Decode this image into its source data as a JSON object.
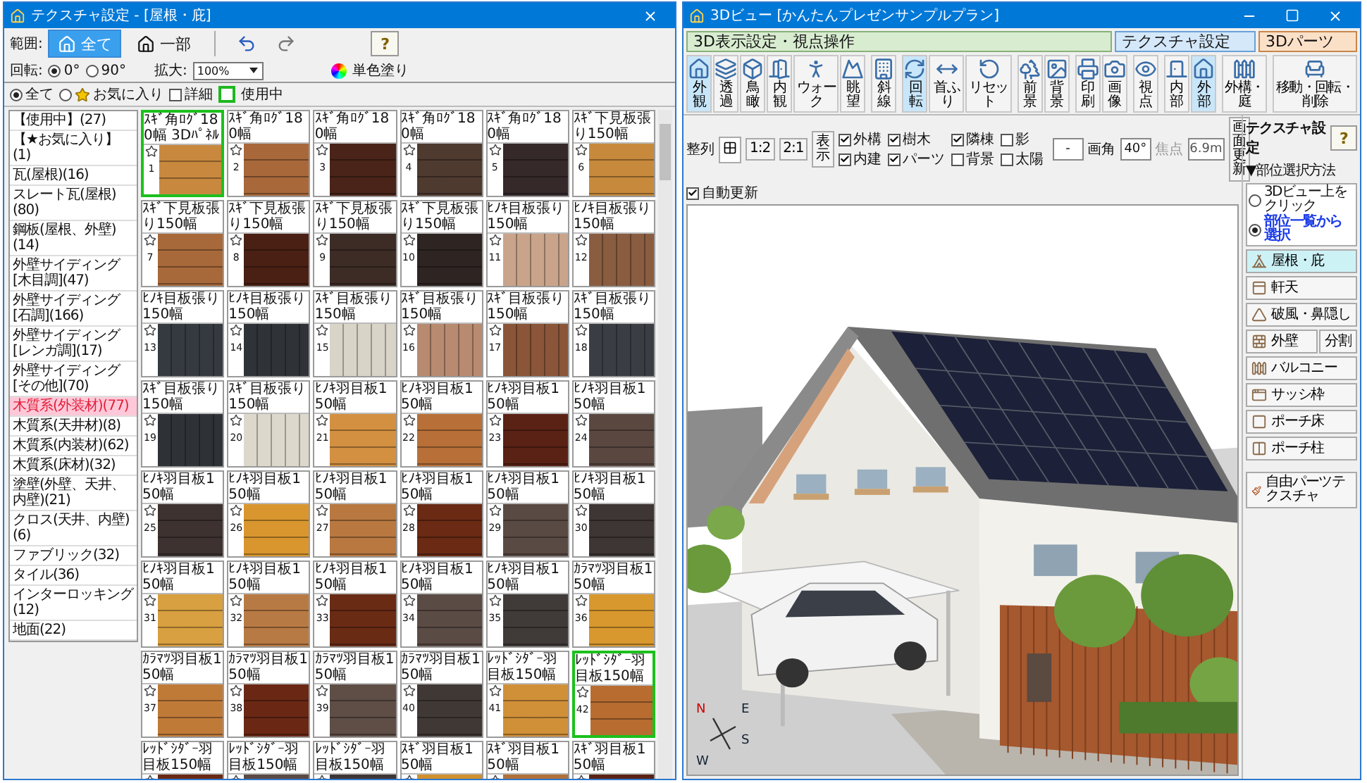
{
  "texture_window": {
    "title": "テクスチャ設定 - [屋根・庇]",
    "range_label": "範囲:",
    "range_options": [
      {
        "label": "全て",
        "selected": true
      },
      {
        "label": "一部",
        "selected": false
      }
    ],
    "help_button": "?",
    "rotation_label": "回転:",
    "rotation_options": [
      {
        "label": "0°",
        "selected": true
      },
      {
        "label": "90°",
        "selected": false
      }
    ],
    "zoom_label": "拡大:",
    "zoom_value": "100%",
    "solid_color_button": "単色塗り",
    "filter_options": [
      {
        "label": "全て",
        "selected": true,
        "kind": "plain"
      },
      {
        "label": "お気に入り",
        "selected": false,
        "kind": "favorite"
      }
    ],
    "detail_checkbox": {
      "label": "詳細",
      "checked": false
    },
    "in_use_legend": "使用中",
    "categories": [
      {
        "label": "【使用中】(27)",
        "selected": false
      },
      {
        "label": "【★お気に入り】(1)",
        "selected": false
      },
      {
        "label": "瓦(屋根)(16)",
        "selected": false
      },
      {
        "label": "スレート瓦(屋根)(80)",
        "selected": false
      },
      {
        "label": "鋼板(屋根、外壁)(14)",
        "selected": false
      },
      {
        "label": "外壁サイディング[木目調](47)",
        "selected": false
      },
      {
        "label": "外壁サイディング[石調](166)",
        "selected": false
      },
      {
        "label": "外壁サイディング[レンガ調](17)",
        "selected": false
      },
      {
        "label": "外壁サイディング[その他](70)",
        "selected": false
      },
      {
        "label": "木質系(外装材)(77)",
        "selected": true
      },
      {
        "label": "木質系(天井材)(8)",
        "selected": false
      },
      {
        "label": "木質系(内装材)(62)",
        "selected": false
      },
      {
        "label": "木質系(床材)(32)",
        "selected": false
      },
      {
        "label": "塗壁(外壁、天井、内壁)(21)",
        "selected": false
      },
      {
        "label": "クロス(天井、内壁)(6)",
        "selected": false
      },
      {
        "label": "ファブリック(32)",
        "selected": false
      },
      {
        "label": "タイル(36)",
        "selected": false
      },
      {
        "label": "インターロッキング(12)",
        "selected": false
      },
      {
        "label": "地面(22)",
        "selected": false
      }
    ],
    "textures": [
      {
        "name": "ｽｷﾞ角ﾛｸﾞ180幅 3Dﾊﾟﾈﾙ",
        "number": "1",
        "color": "#c8893e",
        "kind": "horizontal",
        "in_use": true
      },
      {
        "name": "ｽｷﾞ角ﾛｸﾞ180幅",
        "number": "2",
        "color": "#a8683a",
        "kind": "horizontal",
        "in_use": false
      },
      {
        "name": "ｽｷﾞ角ﾛｸﾞ180幅",
        "number": "3",
        "color": "#4a2418",
        "kind": "horizontal",
        "in_use": false
      },
      {
        "name": "ｽｷﾞ角ﾛｸﾞ180幅",
        "number": "4",
        "color": "#4f3a30",
        "kind": "horizontal",
        "in_use": false
      },
      {
        "name": "ｽｷﾞ角ﾛｸﾞ180幅",
        "number": "5",
        "color": "#35292a",
        "kind": "horizontal",
        "in_use": false
      },
      {
        "name": "ｽｷﾞ下見板張り150幅",
        "number": "6",
        "color": "#c78a3c",
        "kind": "horizontal",
        "in_use": false
      },
      {
        "name": "ｽｷﾞ下見板張り150幅",
        "number": "7",
        "color": "#a8693a",
        "kind": "horizontal",
        "in_use": false
      },
      {
        "name": "ｽｷﾞ下見板張り150幅",
        "number": "8",
        "color": "#4a2014",
        "kind": "horizontal",
        "in_use": false
      },
      {
        "name": "ｽｷﾞ下見板張り150幅",
        "number": "9",
        "color": "#3d2c26",
        "kind": "horizontal",
        "in_use": false
      },
      {
        "name": "ｽｷﾞ下見板張り150幅",
        "number": "10",
        "color": "#2e2522",
        "kind": "horizontal",
        "in_use": false
      },
      {
        "name": "ﾋﾉｷ目板張り150幅",
        "number": "11",
        "color": "#c9a48a",
        "kind": "vertical",
        "in_use": false
      },
      {
        "name": "ﾋﾉｷ目板張り150幅",
        "number": "12",
        "color": "#8a5c40",
        "kind": "vertical",
        "in_use": false
      },
      {
        "name": "ﾋﾉｷ目板張り150幅",
        "number": "13",
        "color": "#353a40",
        "kind": "vertical",
        "in_use": false
      },
      {
        "name": "ﾋﾉｷ目板張り150幅",
        "number": "14",
        "color": "#2f3338",
        "kind": "vertical",
        "in_use": false
      },
      {
        "name": "ｽｷﾞ目板張り150幅",
        "number": "15",
        "color": "#d8d4c8",
        "kind": "vertical",
        "in_use": false
      },
      {
        "name": "ｽｷﾞ目板張り150幅",
        "number": "16",
        "color": "#b88a70",
        "kind": "vertical",
        "in_use": false
      },
      {
        "name": "ｽｷﾞ目板張り150幅",
        "number": "17",
        "color": "#8a5538",
        "kind": "vertical",
        "in_use": false
      },
      {
        "name": "ｽｷﾞ目板張り150幅",
        "number": "18",
        "color": "#3a3e44",
        "kind": "vertical",
        "in_use": false
      },
      {
        "name": "ｽｷﾞ目板張り150幅",
        "number": "19",
        "color": "#2e3236",
        "kind": "vertical",
        "in_use": false
      },
      {
        "name": "ｽｷﾞ目板張り150幅",
        "number": "20",
        "color": "#dcd8cc",
        "kind": "vertical",
        "in_use": false
      },
      {
        "name": "ﾋﾉｷ羽目板150幅",
        "number": "21",
        "color": "#d39040",
        "kind": "horizontal",
        "in_use": false
      },
      {
        "name": "ﾋﾉｷ羽目板150幅",
        "number": "22",
        "color": "#b87038",
        "kind": "horizontal",
        "in_use": false
      },
      {
        "name": "ﾋﾉｷ羽目板150幅",
        "number": "23",
        "color": "#5a2214",
        "kind": "horizontal",
        "in_use": false
      },
      {
        "name": "ﾋﾉｷ羽目板150幅",
        "number": "24",
        "color": "#5a4840",
        "kind": "horizontal",
        "in_use": false
      },
      {
        "name": "ﾋﾉｷ羽目板150幅",
        "number": "25",
        "color": "#3d3230",
        "kind": "horizontal",
        "in_use": false
      },
      {
        "name": "ﾋﾉｷ羽目板150幅",
        "number": "26",
        "color": "#d9962e",
        "kind": "horizontal",
        "in_use": false
      },
      {
        "name": "ﾋﾉｷ羽目板150幅",
        "number": "27",
        "color": "#b87840",
        "kind": "horizontal",
        "in_use": false
      },
      {
        "name": "ﾋﾉｷ羽目板150幅",
        "number": "28",
        "color": "#6a2a14",
        "kind": "horizontal",
        "in_use": false
      },
      {
        "name": "ﾋﾉｷ羽目板150幅",
        "number": "29",
        "color": "#5a4a44",
        "kind": "horizontal",
        "in_use": false
      },
      {
        "name": "ﾋﾉｷ羽目板150幅",
        "number": "30",
        "color": "#3e3634",
        "kind": "horizontal",
        "in_use": false
      },
      {
        "name": "ﾋﾉｷ羽目板150幅",
        "number": "31",
        "color": "#d8a040",
        "kind": "horizontal",
        "in_use": false
      },
      {
        "name": "ﾋﾉｷ羽目板150幅",
        "number": "32",
        "color": "#b87a44",
        "kind": "horizontal",
        "in_use": false
      },
      {
        "name": "ﾋﾉｷ羽目板150幅",
        "number": "33",
        "color": "#6a2b15",
        "kind": "horizontal",
        "in_use": false
      },
      {
        "name": "ﾋﾉｷ羽目板150幅",
        "number": "34",
        "color": "#5b4b45",
        "kind": "horizontal",
        "in_use": false
      },
      {
        "name": "ﾋﾉｷ羽目板150幅",
        "number": "35",
        "color": "#403a38",
        "kind": "horizontal",
        "in_use": false
      },
      {
        "name": "ｶﾗﾏﾂ羽目板150幅",
        "number": "36",
        "color": "#d8982e",
        "kind": "horizontal",
        "in_use": false
      },
      {
        "name": "ｶﾗﾏﾂ羽目板150幅",
        "number": "37",
        "color": "#c07a38",
        "kind": "horizontal",
        "in_use": false
      },
      {
        "name": "ｶﾗﾏﾂ羽目板150幅",
        "number": "38",
        "color": "#6a2814",
        "kind": "horizontal",
        "in_use": false
      },
      {
        "name": "ｶﾗﾏﾂ羽目板150幅",
        "number": "39",
        "color": "#5e4e46",
        "kind": "horizontal",
        "in_use": false
      },
      {
        "name": "ｶﾗﾏﾂ羽目板150幅",
        "number": "40",
        "color": "#403834",
        "kind": "horizontal",
        "in_use": false
      },
      {
        "name": "ﾚｯﾄﾞｼﾀﾞｰ羽目板150幅",
        "number": "41",
        "color": "#d09038",
        "kind": "horizontal",
        "in_use": false
      },
      {
        "name": "ﾚｯﾄﾞｼﾀﾞｰ羽目板150幅",
        "number": "42",
        "color": "#b86c30",
        "kind": "horizontal",
        "in_use": true
      },
      {
        "name": "ﾚｯﾄﾞｼﾀﾞｰ羽目板150幅",
        "color": "#6a2915",
        "kind": "horizontal",
        "in_use": false
      },
      {
        "name": "ﾚｯﾄﾞｼﾀﾞｰ羽目板150幅",
        "color": "#5a4a43",
        "kind": "horizontal",
        "in_use": false
      },
      {
        "name": "ﾚｯﾄﾞｼﾀﾞｰ羽目板150幅",
        "color": "#3e3635",
        "kind": "horizontal",
        "in_use": false
      },
      {
        "name": "ｽｷﾞ羽目板150幅",
        "color": "#d0902e",
        "kind": "horizontal",
        "in_use": false
      },
      {
        "name": "ｽｷﾞ羽目板150幅",
        "color": "#b0703a",
        "kind": "horizontal",
        "in_use": false
      },
      {
        "name": "ｽｷﾞ羽目板150幅",
        "color": "#5a2215",
        "kind": "horizontal",
        "in_use": false
      }
    ]
  },
  "view_window": {
    "title": "3Dビュー [かんたんプレゼンサンプルプラン]",
    "sections": [
      {
        "label": "3D表示設定・視点操作",
        "kind": "view"
      },
      {
        "label": "テクスチャ設定",
        "kind": "texture"
      },
      {
        "label": "3Dパーツ",
        "kind": "parts"
      }
    ],
    "tool_groups": [
      [
        {
          "label": "外観",
          "selected": true
        },
        {
          "label": "透過",
          "selected": false
        },
        {
          "label": "鳥瞰",
          "selected": false
        },
        {
          "label": "内観",
          "selected": false
        },
        {
          "label": "ウォーク",
          "selected": false
        },
        {
          "label": "眺望",
          "selected": false
        }
      ],
      [
        {
          "label": "斜線",
          "selected": false
        }
      ],
      [
        {
          "label": "回転",
          "selected": true
        },
        {
          "label": "首ふり",
          "selected": false
        },
        {
          "label": "リセット",
          "selected": false
        }
      ],
      [
        {
          "label": "前景",
          "selected": false
        },
        {
          "label": "背景",
          "selected": false
        }
      ],
      [
        {
          "label": "印刷",
          "selected": false
        },
        {
          "label": "画像",
          "selected": false
        }
      ],
      [
        {
          "label": "視点",
          "selected": false
        }
      ],
      [
        {
          "label": "内部",
          "selected": false
        },
        {
          "label": "外部",
          "selected": true
        }
      ],
      [
        {
          "label": "外構・庭",
          "selected": false
        }
      ],
      [
        {
          "label": "移動・回転・削除",
          "selected": false
        }
      ]
    ],
    "arrange_label": "整列",
    "arrange_ratios": [
      "1:2",
      "2:1"
    ],
    "display_button": "表示",
    "display_checks": [
      {
        "label": "外構",
        "checked": true
      },
      {
        "label": "内建",
        "checked": true
      },
      {
        "label": "樹木",
        "checked": true
      },
      {
        "label": "パーツ",
        "checked": true
      },
      {
        "label": "隣棟",
        "checked": true
      },
      {
        "label": "背景",
        "checked": false
      },
      {
        "label": "影",
        "checked": false
      },
      {
        "label": "太陽",
        "checked": false
      }
    ],
    "mode_field": "-",
    "angle_label": "画角",
    "angle_value": "40°",
    "focus_label": "焦点",
    "focus_value": "6.9m",
    "focus_disabled": true,
    "refresh_button": "画面更新",
    "auto_refresh": {
      "label": "自動更新",
      "checked": true
    },
    "compass": [
      "N",
      "E",
      "S",
      "W"
    ],
    "panel": {
      "title": "テクスチャ設定",
      "help_button": "?",
      "method_label": "▼部位選択方法",
      "methods": [
        {
          "label": "3Dビュー上をクリック",
          "selected": false
        },
        {
          "label": "部位一覧から選択",
          "selected": true
        }
      ],
      "parts": [
        {
          "label": "屋根・庇",
          "selected": true
        },
        {
          "label": "軒天",
          "selected": false
        },
        {
          "label": "破風・鼻隠し",
          "selected": false
        },
        {
          "label": "外壁",
          "selected": false,
          "split": "分割"
        },
        {
          "label": "バルコニー",
          "selected": false
        },
        {
          "label": "サッシ枠",
          "selected": false
        },
        {
          "label": "ポーチ床",
          "selected": false
        },
        {
          "label": "ポーチ柱",
          "selected": false
        }
      ],
      "free_parts_button": "自由パーツテクスチャ"
    }
  }
}
